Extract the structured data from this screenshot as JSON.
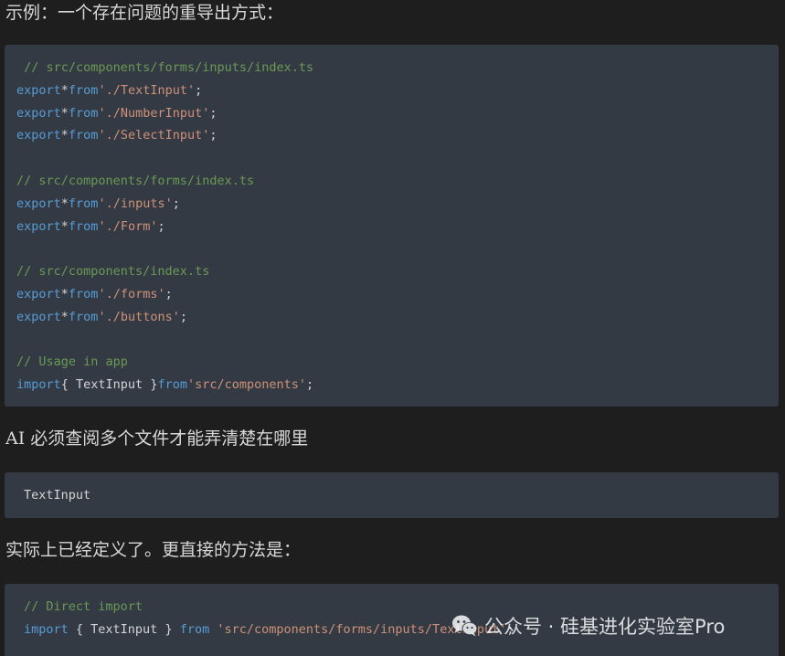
{
  "paragraphs": {
    "intro": "示例：一个存在问题的重导出方式：",
    "middle": "AI 必须查阅多个文件才能弄清楚在哪里",
    "conclusion": "实际上已经定义了。更直接的方法是："
  },
  "code_block_1": {
    "lines": [
      [
        {
          "t": "cm",
          "v": " // src/components/forms/inputs/index.ts"
        }
      ],
      [
        {
          "t": "kw",
          "v": "export"
        },
        {
          "t": "pl",
          "v": "*"
        },
        {
          "t": "kw",
          "v": "from"
        },
        {
          "t": "str",
          "v": "'./TextInput'"
        },
        {
          "t": "pl",
          "v": ";"
        }
      ],
      [
        {
          "t": "kw",
          "v": "export"
        },
        {
          "t": "pl",
          "v": "*"
        },
        {
          "t": "kw",
          "v": "from"
        },
        {
          "t": "str",
          "v": "'./NumberInput'"
        },
        {
          "t": "pl",
          "v": ";"
        }
      ],
      [
        {
          "t": "kw",
          "v": "export"
        },
        {
          "t": "pl",
          "v": "*"
        },
        {
          "t": "kw",
          "v": "from"
        },
        {
          "t": "str",
          "v": "'./SelectInput'"
        },
        {
          "t": "pl",
          "v": ";"
        }
      ],
      [],
      [
        {
          "t": "cm",
          "v": "// src/components/forms/index.ts"
        }
      ],
      [
        {
          "t": "kw",
          "v": "export"
        },
        {
          "t": "pl",
          "v": "*"
        },
        {
          "t": "kw",
          "v": "from"
        },
        {
          "t": "str",
          "v": "'./inputs'"
        },
        {
          "t": "pl",
          "v": ";"
        }
      ],
      [
        {
          "t": "kw",
          "v": "export"
        },
        {
          "t": "pl",
          "v": "*"
        },
        {
          "t": "kw",
          "v": "from"
        },
        {
          "t": "str",
          "v": "'./Form'"
        },
        {
          "t": "pl",
          "v": ";"
        }
      ],
      [],
      [
        {
          "t": "cm",
          "v": "// src/components/index.ts"
        }
      ],
      [
        {
          "t": "kw",
          "v": "export"
        },
        {
          "t": "pl",
          "v": "*"
        },
        {
          "t": "kw",
          "v": "from"
        },
        {
          "t": "str",
          "v": "'./forms'"
        },
        {
          "t": "pl",
          "v": ";"
        }
      ],
      [
        {
          "t": "kw",
          "v": "export"
        },
        {
          "t": "pl",
          "v": "*"
        },
        {
          "t": "kw",
          "v": "from"
        },
        {
          "t": "str",
          "v": "'./buttons'"
        },
        {
          "t": "pl",
          "v": ";"
        }
      ],
      [],
      [
        {
          "t": "cm",
          "v": "// Usage in app"
        }
      ],
      [
        {
          "t": "kw",
          "v": "import"
        },
        {
          "t": "pl",
          "v": "{ TextInput }"
        },
        {
          "t": "kw",
          "v": "from"
        },
        {
          "t": "str",
          "v": "'src/components'"
        },
        {
          "t": "pl",
          "v": ";"
        }
      ]
    ]
  },
  "code_block_2": {
    "lines": [
      [
        {
          "t": "pl",
          "v": "TextInput"
        }
      ]
    ]
  },
  "code_block_3": {
    "lines": [
      [
        {
          "t": "cm",
          "v": "// Direct import"
        }
      ],
      [
        {
          "t": "kw",
          "v": "import"
        },
        {
          "t": "pl",
          "v": " { TextInput } "
        },
        {
          "t": "kw",
          "v": "from"
        },
        {
          "t": "pl",
          "v": " "
        },
        {
          "t": "str",
          "v": "'src/components/forms/inputs/TextInput'"
        },
        {
          "t": "pl",
          "v": ";"
        }
      ]
    ]
  },
  "watermark": {
    "icon": "wechat-icon",
    "text": "公众号 · 硅基进化实验室Pro"
  },
  "colors": {
    "background": "#1e1e1e",
    "code_background": "#343a44",
    "comment": "#6a9955",
    "keyword": "#569cd6",
    "string": "#ce9178",
    "plain": "#d4d4d4"
  }
}
